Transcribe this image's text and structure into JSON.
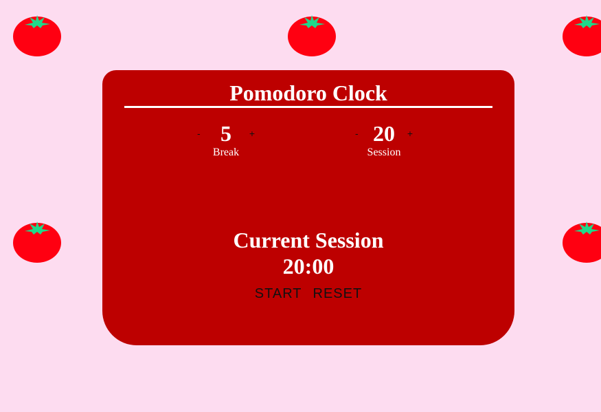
{
  "app": {
    "title": "Pomodoro Clock"
  },
  "break": {
    "decrement_label": "-",
    "value": "5",
    "increment_label": "+",
    "label": "Break"
  },
  "session": {
    "decrement_label": "-",
    "value": "20",
    "increment_label": "+",
    "label": "Session"
  },
  "timer": {
    "label": "Current Session",
    "value": "20:00"
  },
  "actions": {
    "start_label": "START",
    "reset_label": "RESET"
  },
  "colors": {
    "background": "#fddcf0",
    "card": "#bd0000",
    "tomato": "#ff0011",
    "leaf": "#20d98a"
  },
  "icons": {
    "decoration": "tomato-icon"
  }
}
